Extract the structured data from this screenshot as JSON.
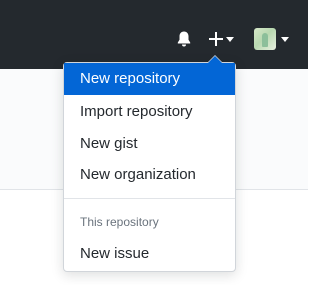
{
  "header": {
    "notifications_icon": "bell-icon",
    "create_icon": "plus-icon",
    "create_caret_icon": "caret-down-icon",
    "avatar_caret_icon": "caret-down-icon"
  },
  "create_menu": {
    "items": [
      {
        "label": "New repository",
        "active": true
      },
      {
        "label": "Import repository"
      },
      {
        "label": "New gist"
      },
      {
        "label": "New organization"
      }
    ],
    "section_header": "This repository",
    "section_items": [
      {
        "label": "New issue"
      }
    ]
  },
  "colors": {
    "header_bg": "#24292e",
    "active_item_bg": "#0366d6",
    "text": "#24292e",
    "muted_text": "#6a737d"
  }
}
